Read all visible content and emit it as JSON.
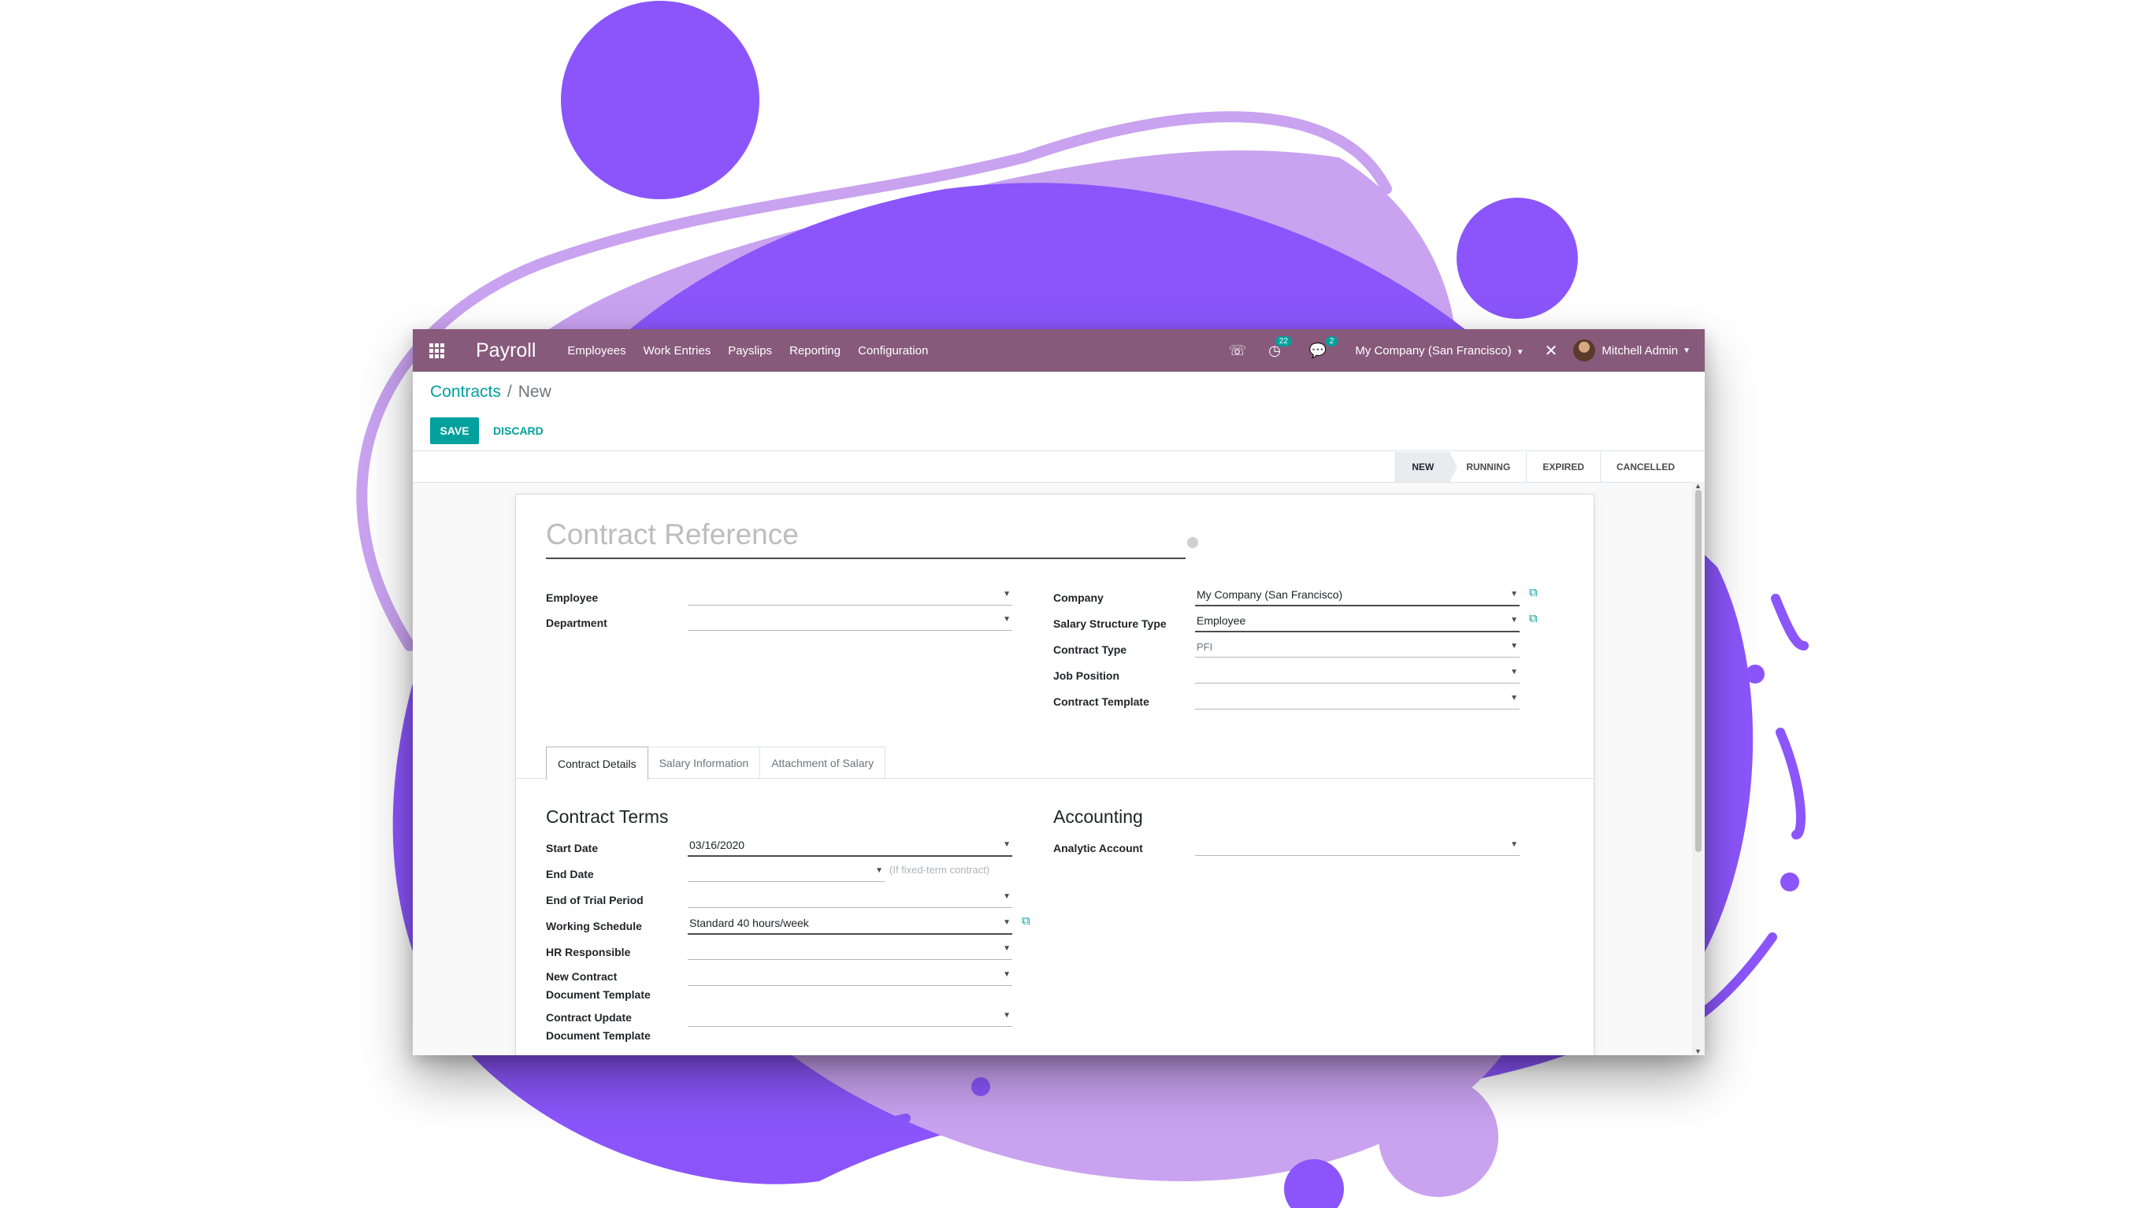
{
  "colors": {
    "navbar": "#875a7b",
    "accent": "#00a09d",
    "blob_dark": "#8b55fb",
    "blob_light": "#c9a2f0"
  },
  "navbar": {
    "apps_icon": "grid-icon",
    "app_name": "Payroll",
    "menu": [
      "Employees",
      "Work Entries",
      "Payslips",
      "Reporting",
      "Configuration"
    ],
    "phone_icon": "phone-icon",
    "activity_icon": "clock-icon",
    "activity_count": "22",
    "messages_icon": "chat-icon",
    "messages_count": "2",
    "company": "My Company (San Francisco)",
    "close_icon": "close-icon",
    "user": "Mitchell Admin"
  },
  "breadcrumb": {
    "parent": "Contracts",
    "separator": "/",
    "current": "New"
  },
  "buttons": {
    "save": "SAVE",
    "discard": "DISCARD"
  },
  "status_steps": [
    "NEW",
    "RUNNING",
    "EXPIRED",
    "CANCELLED"
  ],
  "status_active": "NEW",
  "form": {
    "title_placeholder": "Contract Reference",
    "left": {
      "employee_label": "Employee",
      "employee_value": "",
      "department_label": "Department",
      "department_value": ""
    },
    "right": {
      "company_label": "Company",
      "company_value": "My Company (San Francisco)",
      "salary_structure_label": "Salary Structure Type",
      "salary_structure_value": "Employee",
      "contract_type_label": "Contract Type",
      "contract_type_value": "PFI",
      "job_position_label": "Job Position",
      "job_position_value": "",
      "contract_template_label": "Contract Template",
      "contract_template_value": ""
    },
    "tabs": [
      "Contract Details",
      "Salary Information",
      "Attachment of Salary"
    ],
    "terms": {
      "title": "Contract Terms",
      "start_date_label": "Start Date",
      "start_date_value": "03/16/2020",
      "end_date_label": "End Date",
      "end_date_value": "",
      "end_date_hint": "(If fixed-term contract)",
      "trial_label": "End of Trial Period",
      "trial_value": "",
      "schedule_label": "Working Schedule",
      "schedule_value": "Standard 40 hours/week",
      "hr_label": "HR Responsible",
      "hr_value": "",
      "new_doc_label_1": "New Contract",
      "new_doc_label_2": "Document Template",
      "new_doc_value": "",
      "update_doc_label_1": "Contract Update",
      "update_doc_label_2": "Document Template",
      "update_doc_value": ""
    },
    "accounting": {
      "title": "Accounting",
      "analytic_label": "Analytic Account",
      "analytic_value": ""
    }
  }
}
